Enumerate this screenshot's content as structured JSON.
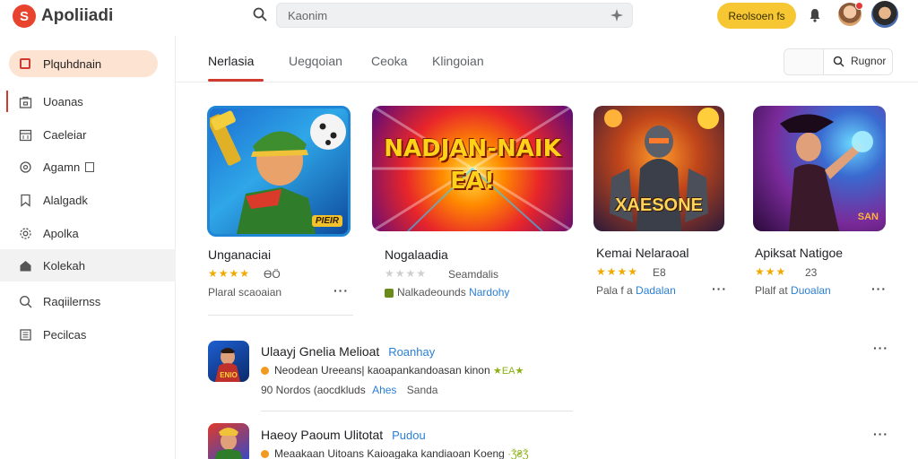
{
  "header": {
    "logo_glyph": "S",
    "app_name": "Apoliiadi",
    "search_placeholder": "Kaonim",
    "cta_label": "Reolsoen fs"
  },
  "sidebar": {
    "home_label": "Plquhdnain",
    "items": [
      {
        "label": "Uoanas",
        "icon": "store-icon"
      },
      {
        "label": "Caeleiar",
        "icon": "calendar-icon"
      },
      {
        "label": "Agamn",
        "icon": "gamepad-icon"
      },
      {
        "label": "Alalgadk",
        "icon": "bookmark-icon"
      },
      {
        "label": "Apolka",
        "icon": "settings-icon"
      },
      {
        "label": "Kolekah",
        "icon": "home-icon"
      },
      {
        "label": "Raqiilernss",
        "icon": "search-icon"
      },
      {
        "label": "Pecilcas",
        "icon": "library-icon"
      }
    ]
  },
  "tabs": {
    "items": [
      "Nerlasia",
      "Uegqoian",
      "Ceoka",
      "Klingoian"
    ],
    "active": "Nerlasia",
    "filter_label": "Rugnor"
  },
  "cards": [
    {
      "title": "Unganaciai",
      "stars": "★★★★",
      "score": "ƟÖ",
      "meta": "Plaral scaoaian",
      "thumb_caption": "PIEIR"
    },
    {
      "title": "Nogalaadia",
      "stars": "★★★★",
      "score": "Seamdalis",
      "meta_prefix": "Nalkadeounds",
      "meta_link": "Nardohy",
      "thumb_caption": "NADJAN-NAIKEA!"
    },
    {
      "title": "Kemai Nelaraoal",
      "stars": "★★★★",
      "score": "E8",
      "meta_prefix": "Pala f a",
      "meta_link": "Dadalan",
      "thumb_caption": "XAESONE"
    },
    {
      "title": "Apiksat Natigoe",
      "stars": "★★★",
      "score": "23",
      "meta_prefix": "Plalf at",
      "meta_link": "Duoalan",
      "thumb_caption": "SAN"
    }
  ],
  "list": [
    {
      "title": "Ulaayj Gnelia Melioat",
      "title_link": "Roanhay",
      "sub1": "Neodean Ureeans| kaoapankandoasan kinon",
      "sub1_stars": "★EA★",
      "sub2_prefix": "90  Nordos (aocdkluds",
      "sub2_link": "Ahes",
      "sub2_suffix": "Sanda",
      "icon_caption": "ENIO"
    },
    {
      "title": "Haeoy Paoum Ulitotat",
      "title_link": "Pudou",
      "sub1": "Meaakaan Uitoans Kaioagaka kandiaoan Koeng",
      "sub1_stars": "·Ǯ₴Ǯ",
      "icon_caption": ""
    }
  ],
  "colors": {
    "accent": "#d13a2f",
    "cta": "#f7c733",
    "link": "#2a7fd4",
    "star": "#f2a900"
  }
}
